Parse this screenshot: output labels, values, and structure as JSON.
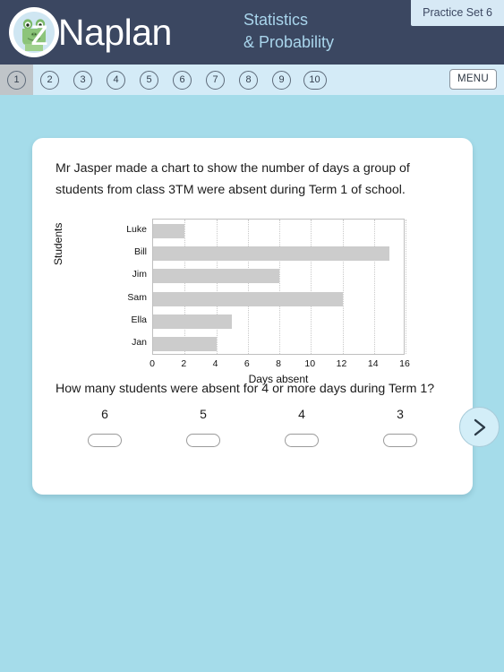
{
  "header": {
    "brand": "z Naplan",
    "logo_icon": "crocodile-logo-icon",
    "subject_line1": "Statistics",
    "subject_line2": "& Probability",
    "practice_set": "Practice Set 6",
    "colors": {
      "header_bg": "#3b4761",
      "nav_bg": "#d4ebf7",
      "page_bg": "#a5dcea",
      "accent_text": "#a9d5ec",
      "tab_bg": "#d7e9f5"
    }
  },
  "nav": {
    "items": [
      {
        "label": "1",
        "active": true
      },
      {
        "label": "2",
        "active": false
      },
      {
        "label": "3",
        "active": false
      },
      {
        "label": "4",
        "active": false
      },
      {
        "label": "5",
        "active": false
      },
      {
        "label": "6",
        "active": false
      },
      {
        "label": "7",
        "active": false
      },
      {
        "label": "8",
        "active": false
      },
      {
        "label": "9",
        "active": false
      },
      {
        "label": "10",
        "active": false
      }
    ],
    "menu_label": "MENU"
  },
  "card": {
    "prompt": "Mr Jasper made a chart to show the number of days a group of students from class 3TM were absent during Term 1 of school.",
    "question": "How many students were absent for 4 or more days during Term 1?",
    "options": [
      {
        "label": "6",
        "selected": false
      },
      {
        "label": "5",
        "selected": false
      },
      {
        "label": "4",
        "selected": false
      },
      {
        "label": "3",
        "selected": false
      }
    ],
    "next_icon": "chevron-right-icon"
  },
  "chart_data": {
    "type": "bar",
    "orientation": "horizontal",
    "title": "",
    "categories": [
      "Luke",
      "Bill",
      "Jim",
      "Sam",
      "Ella",
      "Jan"
    ],
    "values": [
      2,
      15,
      8,
      12,
      5,
      4
    ],
    "xlabel": "Days absent",
    "ylabel": "Students",
    "xlim": [
      0,
      16
    ],
    "xticks": [
      0,
      2,
      4,
      6,
      8,
      10,
      12,
      14,
      16
    ],
    "grid": "vertical-dotted",
    "legend": "none",
    "bar_color": "#cccccc"
  }
}
